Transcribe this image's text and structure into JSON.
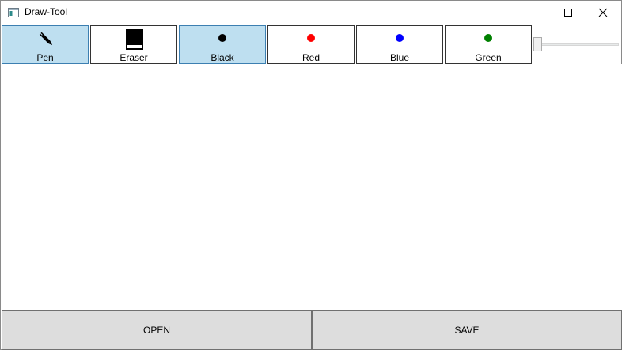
{
  "window": {
    "title": "Draw-Tool"
  },
  "toolbar": {
    "tools": [
      {
        "label": "Pen",
        "icon": "pen-icon",
        "selected": true
      },
      {
        "label": "Eraser",
        "icon": "eraser-icon",
        "selected": false
      }
    ],
    "colors": [
      {
        "label": "Black",
        "hex": "#000000",
        "selected": true
      },
      {
        "label": "Red",
        "hex": "#ff0000",
        "selected": false
      },
      {
        "label": "Blue",
        "hex": "#0000ff",
        "selected": false
      },
      {
        "label": "Green",
        "hex": "#008000",
        "selected": false
      }
    ],
    "brush_size_slider": {
      "value_fraction": 0.0
    }
  },
  "actions": {
    "open_label": "OPEN",
    "save_label": "SAVE"
  },
  "theme": {
    "selected_bg": "#bedff0",
    "button_bg": "#dddddd"
  }
}
